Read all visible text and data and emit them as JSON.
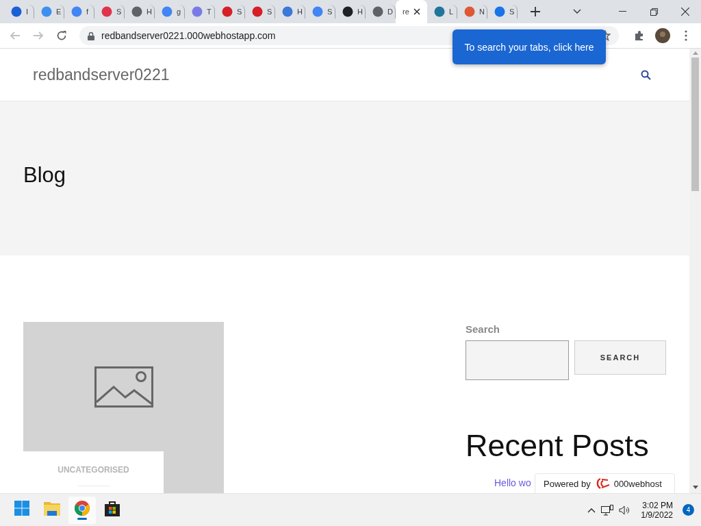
{
  "browser": {
    "tabs": [
      {
        "label": "I",
        "selected": false,
        "color": "#1a5fd6"
      },
      {
        "label": "E",
        "selected": false,
        "color": "#3d8ff0"
      },
      {
        "label": "f",
        "selected": false,
        "color": "#4285f4"
      },
      {
        "label": "S",
        "selected": false,
        "color": "#e0344b"
      },
      {
        "label": "H",
        "selected": false,
        "color": "#5f6368"
      },
      {
        "label": "g",
        "selected": false,
        "color": "#4285f4"
      },
      {
        "label": "T",
        "selected": false,
        "color": "#7a7ae6"
      },
      {
        "label": "S",
        "selected": false,
        "color": "#d61f26"
      },
      {
        "label": "S",
        "selected": false,
        "color": "#d61f26"
      },
      {
        "label": "H",
        "selected": false,
        "color": "#3b78d8"
      },
      {
        "label": "S",
        "selected": false,
        "color": "#4285f4"
      },
      {
        "label": "H",
        "selected": false,
        "color": "#202124"
      },
      {
        "label": "D",
        "selected": false,
        "color": "#5f6368"
      },
      {
        "label": "re",
        "selected": true
      },
      {
        "label": "L",
        "selected": false,
        "color": "#21759b"
      },
      {
        "label": "N",
        "selected": false,
        "color": "#de5833"
      },
      {
        "label": "S",
        "selected": false,
        "color": "#1a73e8"
      }
    ],
    "url": "redbandserver0221.000webhostapp.com",
    "tooltip": "To search your tabs, click here"
  },
  "site": {
    "title": "redbandserver0221",
    "page_title": "Blog",
    "post": {
      "category": "UNCATEGORISED"
    },
    "sidebar": {
      "search_label": "Search",
      "search_button": "SEARCH",
      "recent_title": "Recent Posts",
      "recent_posts": [
        "Hello wo"
      ]
    },
    "badge": {
      "prefix": "Powered by",
      "brand": "000webhost"
    }
  },
  "taskbar": {
    "apps": [
      {
        "kind": "start",
        "selected": false
      },
      {
        "kind": "folder",
        "selected": false
      },
      {
        "kind": "chrome",
        "selected": true
      },
      {
        "kind": "store",
        "selected": false
      }
    ],
    "time": "3:02 PM",
    "date": "1/9/2022",
    "notifications": "4"
  }
}
